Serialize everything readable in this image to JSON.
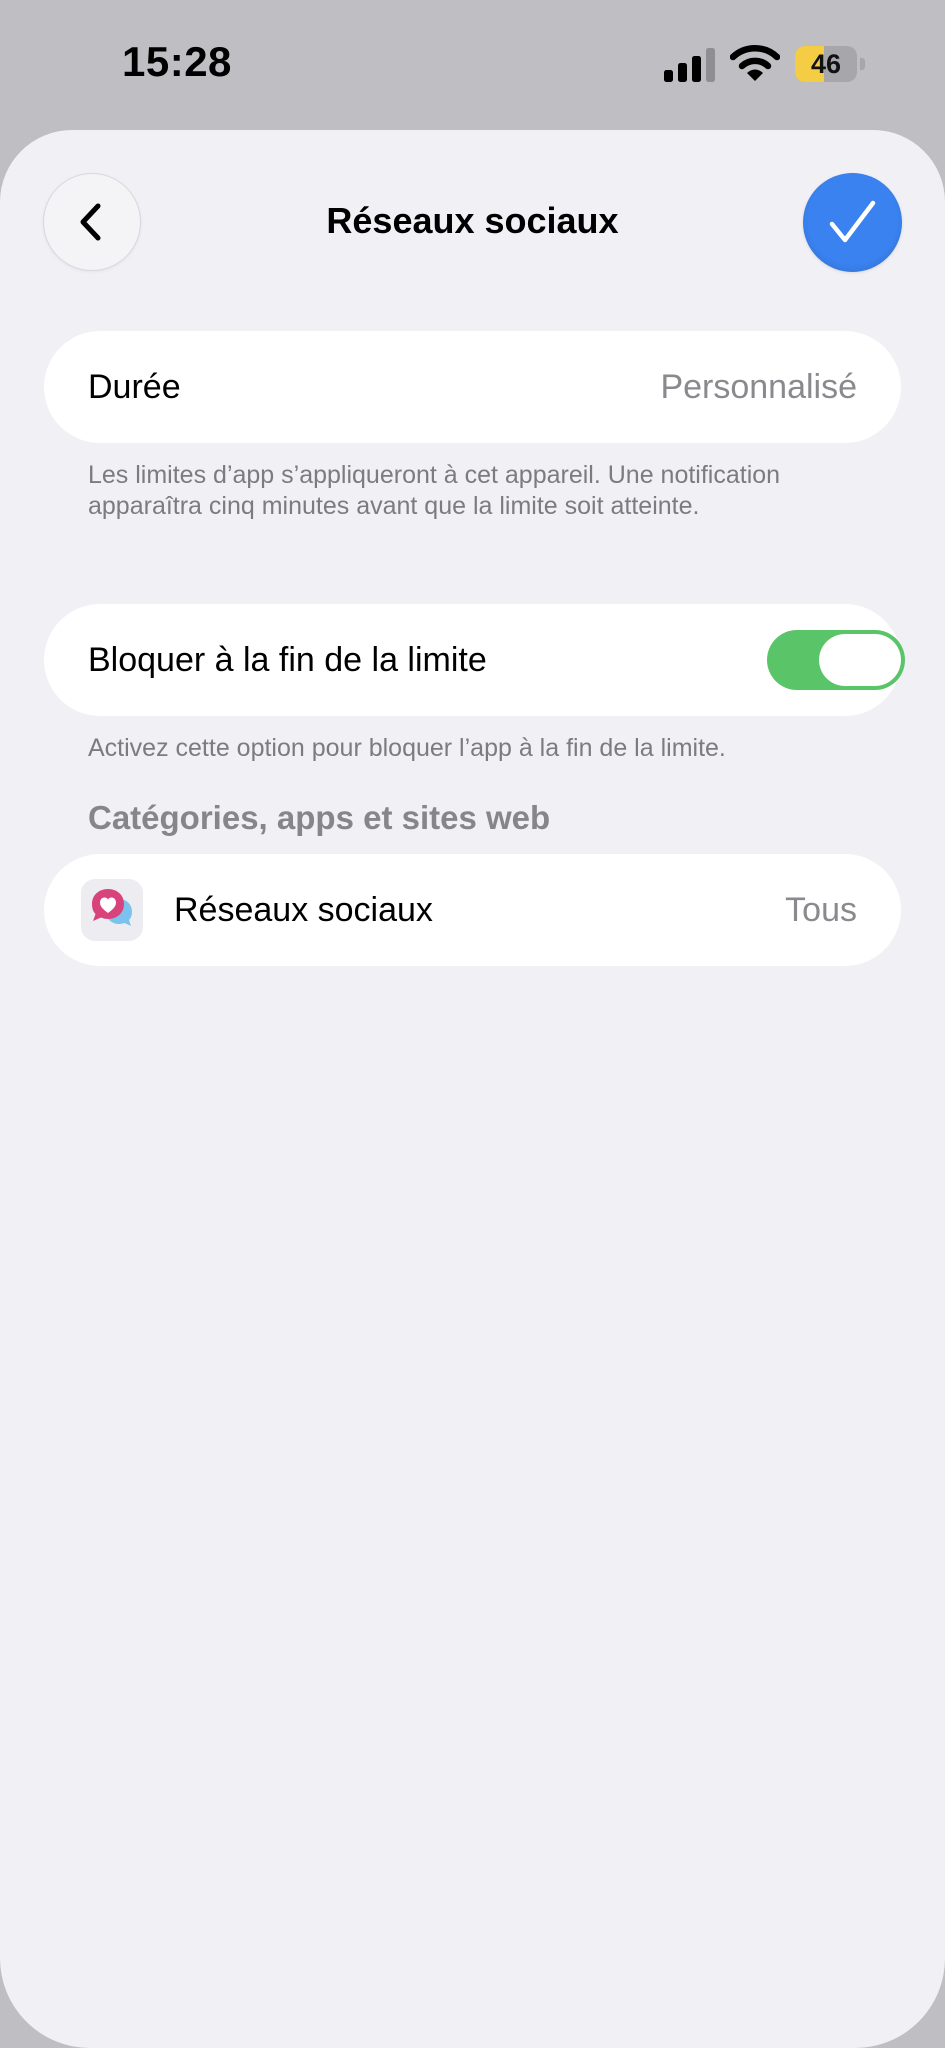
{
  "status_bar": {
    "time": "15:28",
    "battery_percent": 46,
    "battery_label": "46",
    "signal_icon": "cellular-signal-icon",
    "wifi_icon": "wifi-icon",
    "battery_color": "#f5cd45"
  },
  "nav": {
    "back_icon": "chevron-left-icon",
    "title": "Réseaux sociaux",
    "confirm_icon": "checkmark-icon",
    "confirm_color": "#3a82f0"
  },
  "duration": {
    "label": "Durée",
    "value": "Personnalisé",
    "footnote": "Les limites d’app s’appliqueront à cet appareil. Une notification apparaîtra cinq minutes avant que la limite soit atteinte."
  },
  "block": {
    "label": "Bloquer à la fin de la limite",
    "enabled": true,
    "toggle_color": "#5ac468",
    "footnote": "Activez cette option pour bloquer l’app à la fin de la limite."
  },
  "categories": {
    "section_title": "Catégories, apps et sites web",
    "items": [
      {
        "icon": "social-networks-bubble-heart-icon",
        "label": "Réseaux sociaux",
        "value": "Tous"
      }
    ]
  }
}
